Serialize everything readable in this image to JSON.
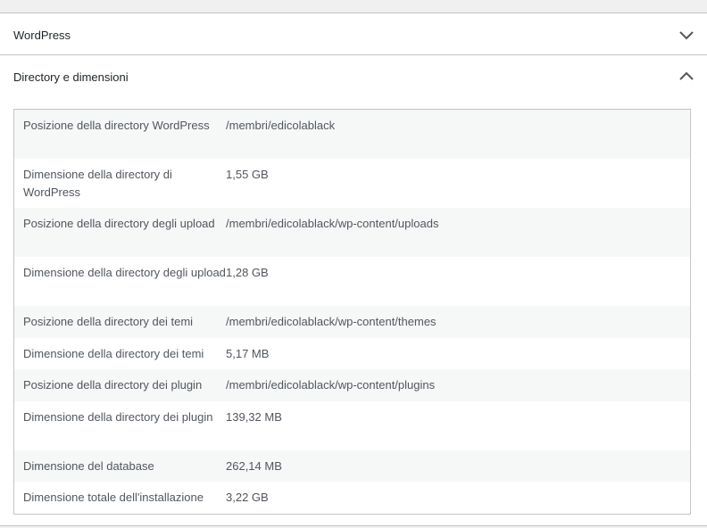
{
  "sections": [
    {
      "title": "WordPress",
      "expanded": false,
      "icon": "chevron-down-icon"
    },
    {
      "title": "Directory e dimensioni",
      "expanded": true,
      "icon": "chevron-up-icon"
    }
  ],
  "rows": [
    {
      "label": "Posizione della directory WordPress",
      "value": "/membri/edicolablack"
    },
    {
      "label": "Dimensione della directory di WordPress",
      "value": "1,55 GB"
    },
    {
      "label": "Posizione della directory degli upload",
      "value": "/membri/edicolablack/wp-content/uploads"
    },
    {
      "label": "Dimensione della directory degli upload",
      "value": "1,28 GB"
    },
    {
      "label": "Posizione della directory dei temi",
      "value": "/membri/edicolablack/wp-content/themes"
    },
    {
      "label": "Dimensione della directory dei temi",
      "value": "5,17 MB"
    },
    {
      "label": "Posizione della directory dei plugin",
      "value": "/membri/edicolablack/wp-content/plugins"
    },
    {
      "label": "Dimensione della directory dei plugin",
      "value": "139,32 MB"
    },
    {
      "label": "Dimensione del database",
      "value": "262,14 MB"
    },
    {
      "label": "Dimensione totale dell'installazione",
      "value": "3,22 GB"
    }
  ],
  "colors": {
    "page_background": "#f0f0f1",
    "panel_border": "#c3c4c7",
    "row_alt": "#f6f7f7",
    "text": "#50575e"
  }
}
